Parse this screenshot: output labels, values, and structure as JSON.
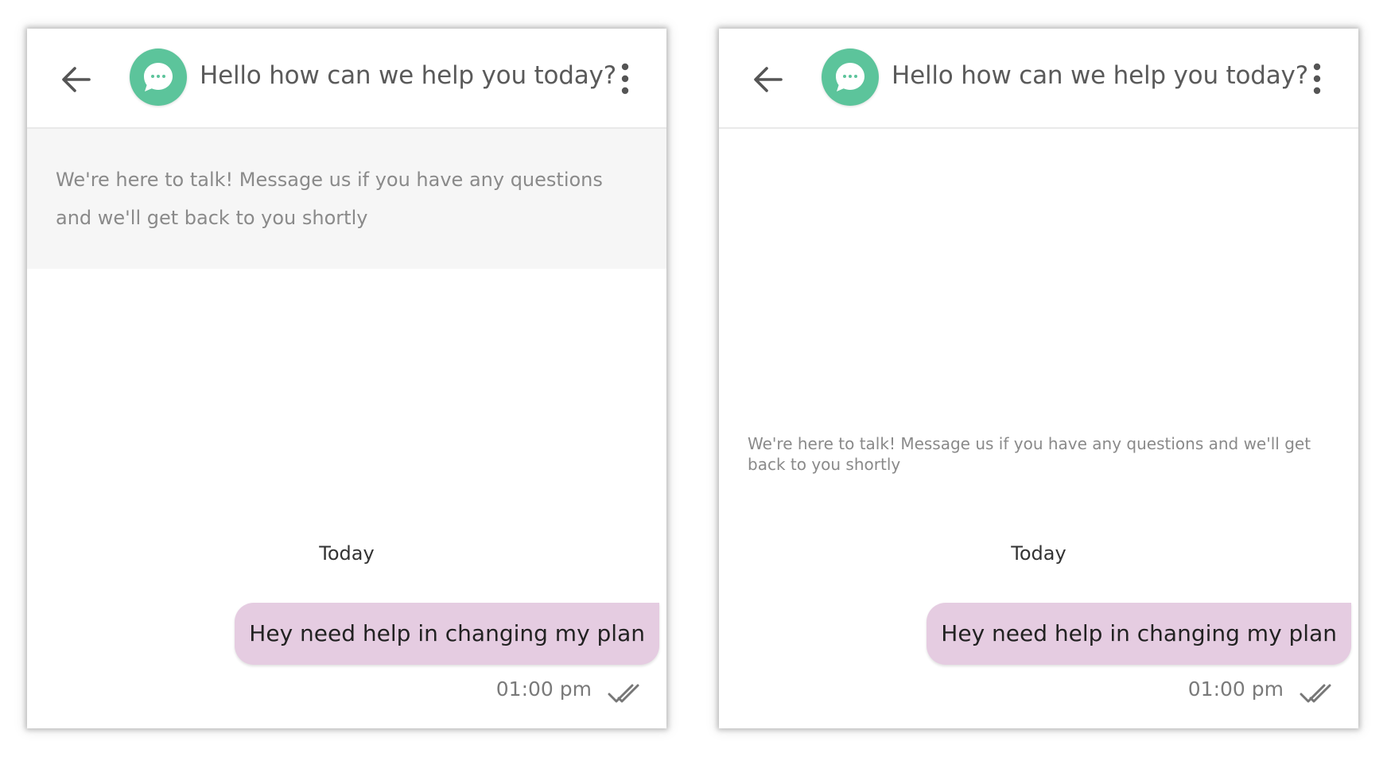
{
  "screens": [
    {
      "header": {
        "title": "Hello how can we help you today?",
        "back_icon": "arrow-left-icon",
        "avatar_icon": "chat-bubble-icon",
        "menu_icon": "more-vertical-icon"
      },
      "notice": "We're here to talk! Message us if you have any questions and we'll get back to you shortly",
      "day_label": "Today",
      "message": {
        "text": "Hey need help in changing my plan",
        "time": "01:00 pm",
        "status_icon": "double-check-icon"
      }
    },
    {
      "header": {
        "title": "Hello how can we help you today?",
        "back_icon": "arrow-left-icon",
        "avatar_icon": "chat-bubble-icon",
        "menu_icon": "more-vertical-icon"
      },
      "notice": "We're here to talk! Message us if you have any questions and we'll get back to you shortly",
      "day_label": "Today",
      "message": {
        "text": "Hey need help in changing my plan",
        "time": "01:00 pm",
        "status_icon": "double-check-icon"
      }
    }
  ],
  "colors": {
    "avatar": "#5cc49b",
    "bubble": "#e5cce1",
    "notice_bg": "#f6f6f6"
  }
}
